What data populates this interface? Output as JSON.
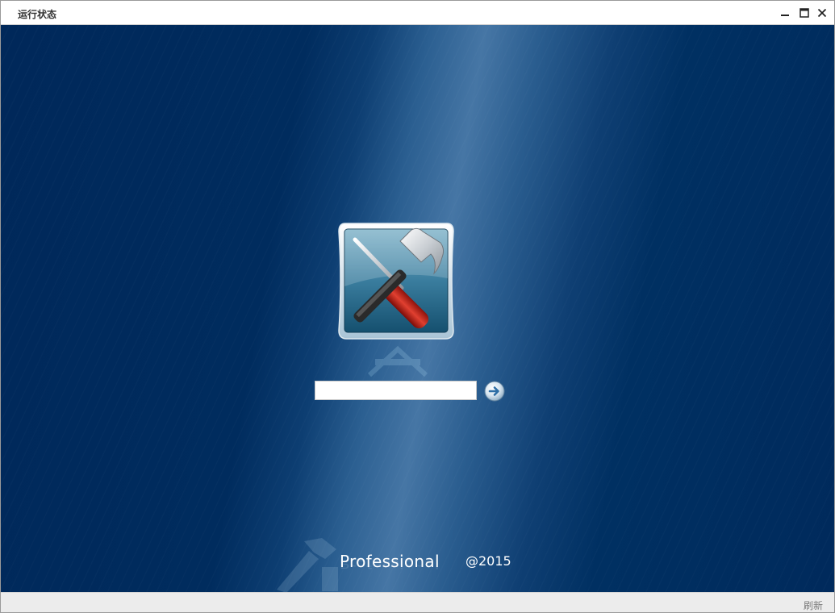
{
  "window": {
    "title": "运行状态",
    "controls": {
      "minimize": "minimize-icon",
      "maximize": "maximize-icon",
      "close": "close-icon"
    }
  },
  "main": {
    "app_icon": "hammer-screwdriver-tools-icon",
    "login": {
      "input_value": "",
      "input_placeholder": "",
      "submit_icon": "arrow-right-circle-icon"
    },
    "product_name": "Professional",
    "copyright": "@2015"
  },
  "statusbar": {
    "refresh_label": "刷新"
  },
  "colors": {
    "background_dark": "#002a5c",
    "background_light": "#4676a5",
    "icon_frame": "#1b5f86",
    "screwdriver_handle": "#c0281c",
    "arrow_button": "#2e6ea5"
  }
}
